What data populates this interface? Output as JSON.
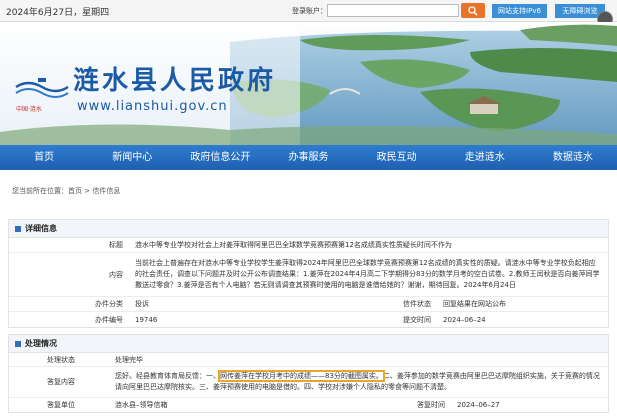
{
  "topbar": {
    "date": "2024年6月27日，星期四",
    "login_label": "登录账户：",
    "search_placeholder": "",
    "ipv6_label": "网站支持IPv6",
    "access_label": "无障碍浏览"
  },
  "banner": {
    "title": "涟水县人民政府",
    "url": "www.lianshui.gov.cn",
    "slogan": "中国·涟水"
  },
  "nav": {
    "items": [
      "首页",
      "新闻中心",
      "政府信息公开",
      "办事服务",
      "政民互动",
      "走进涟水",
      "数据涟水"
    ]
  },
  "breadcrumb": "您当前所在位置：首页 > 信件信息",
  "detail": {
    "heading": "详细信息",
    "title_label": "标题",
    "title_value": "涟水中等专业学校对社会上对姜萍取得阿里巴巴全球数学竞赛预赛第12名成绩真实性质疑长时间不作为",
    "content_label": "内容",
    "content_value": "当前社会上普遍存在对涟水中等专业学校学生姜萍取得2024年阿里巴巴全球数学竞赛预赛第12名成绩的真实性的质疑。请涟水中等专业学校负起相应的社会责任，调查以下问题并及时公开公布调查结果：1.姜萍在2024年4月高二下学期得分83分的数学月考的空白试卷。2.教师王闰秋是否向姜萍同学撒送过零食？3.姜萍是否有个人电脑？若无则请调查其预赛时使用的电脑是谁借给她的？谢谢，期待回复。2024年6月24日",
    "category_label": "办件分类",
    "category_value": "投诉",
    "status_label": "信件状态",
    "status_value": "回复结果在网站公布",
    "number_label": "办件编号",
    "number_value": "19746",
    "submit_label": "提交时间",
    "submit_value": "2024–06–24"
  },
  "handling": {
    "heading": "处理情况",
    "state_label": "处理状态",
    "state_value": "处理完毕",
    "reply_label": "答复内容",
    "reply_prefix": "您好。经县教育体育局反馈：一、",
    "reply_highlight": "网传姜萍在学校月考中的成绩——83分的截图属实。",
    "reply_rest": "二、姜萍参加的数学竞赛由阿里巴巴达摩院组织实施，关于竞赛的情况请向阿里巴巴达摩院核实。三、姜萍预赛使用的电脑是借的。四、学校对涉嫌个人隐私的零食等问题不清楚。",
    "unit_label": "答复单位",
    "unit_value": "涟水县–领导信箱",
    "reply_time_label": "答复时间",
    "reply_time_value": "2024–06–27"
  },
  "colors": {
    "nav_blue": "#1e5fb0",
    "brand_blue": "#1a5aa6",
    "search_orange": "#e8742c",
    "highlight": "#e9a62a"
  }
}
